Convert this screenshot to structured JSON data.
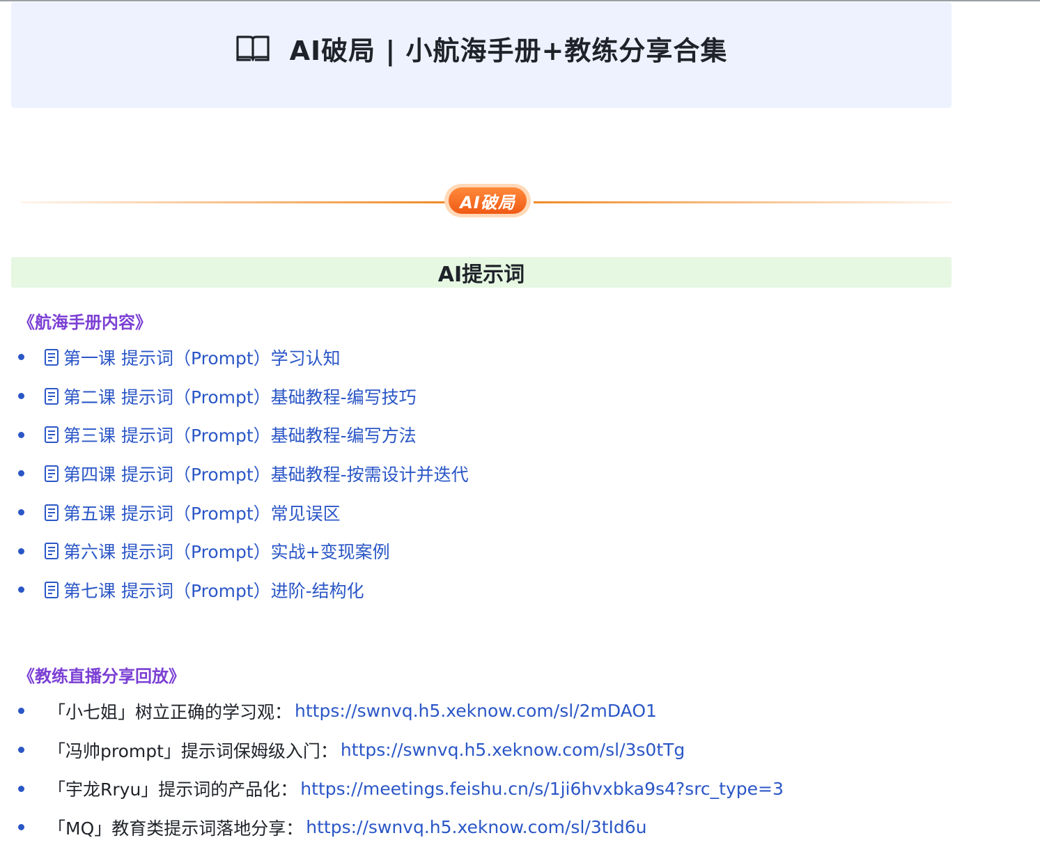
{
  "page": {
    "title": "AI破局 | 小航海手册+教练分享合集",
    "title_icon": "open-book-icon"
  },
  "divider": {
    "badge": "AI破局",
    "colors": {
      "line": "#f08a24",
      "badge": "#f05a14"
    }
  },
  "section": {
    "heading": "AI提示词",
    "manual": {
      "subheading": "《航海手册内容》",
      "items": [
        {
          "label": "第一课  提示词（Prompt）学习认知",
          "icon": "doc-icon"
        },
        {
          "label": "第二课 提示词（Prompt）基础教程-编写技巧",
          "icon": "doc-icon"
        },
        {
          "label": "第三课  提示词（Prompt）基础教程-编写方法",
          "icon": "doc-icon"
        },
        {
          "label": "第四课 提示词（Prompt）基础教程-按需设计并迭代",
          "icon": "doc-icon"
        },
        {
          "label": "第五课 提示词（Prompt）常见误区",
          "icon": "doc-icon"
        },
        {
          "label": "第六课 提示词（Prompt）实战+变现案例",
          "icon": "doc-icon"
        },
        {
          "label": "第七课 提示词（Prompt）进阶-结构化",
          "icon": "doc-icon"
        }
      ]
    },
    "replays": {
      "subheading": "《教练直播分享回放》",
      "items": [
        {
          "label": "「小七姐」树立正确的学习观：",
          "url": "https://swnvq.h5.xeknow.com/sl/2mDAO1"
        },
        {
          "label": "「冯帅prompt」提示词保姆级入门：",
          "url": "https://swnvq.h5.xeknow.com/sl/3s0tTg"
        },
        {
          "label": "「宇龙Rryu」提示词的产品化：",
          "url": "https://meetings.feishu.cn/s/1ji6hvxbka9s4?src_type=3"
        },
        {
          "label": "「MQ」教育类提示词落地分享：",
          "url": "https://swnvq.h5.xeknow.com/sl/3tId6u"
        }
      ]
    }
  },
  "colors": {
    "title_banner_bg": "#edf2fe",
    "section_header_bg": "#e6f7e2",
    "subheading": "#7b3fd4",
    "link": "#2a56c6"
  }
}
